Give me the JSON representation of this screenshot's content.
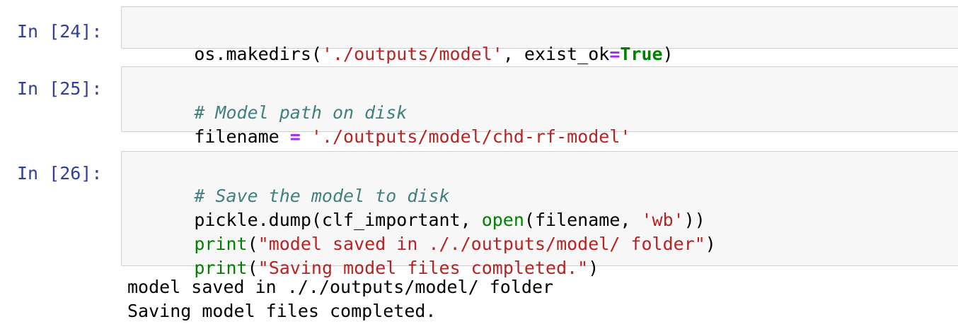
{
  "cells": [
    {
      "prompt": "In [24]:",
      "lines": [
        [
          {
            "t": "os.makedirs(",
            "c": "plain"
          },
          {
            "t": "'./outputs/model'",
            "c": "string"
          },
          {
            "t": ", exist_ok",
            "c": "plain"
          },
          {
            "t": "=",
            "c": "op"
          },
          {
            "t": "True",
            "c": "keyword"
          },
          {
            "t": ")",
            "c": "plain"
          }
        ]
      ]
    },
    {
      "prompt": "In [25]:",
      "lines": [
        [
          {
            "t": "# Model path on disk",
            "c": "comment"
          }
        ],
        [
          {
            "t": "filename ",
            "c": "plain"
          },
          {
            "t": "=",
            "c": "op"
          },
          {
            "t": " ",
            "c": "plain"
          },
          {
            "t": "'./outputs/model/chd-rf-model'",
            "c": "string"
          }
        ]
      ]
    },
    {
      "prompt": "In [26]:",
      "lines": [
        [
          {
            "t": "# Save the model to disk",
            "c": "comment"
          }
        ],
        [
          {
            "t": "pickle.dump(clf_important, ",
            "c": "plain"
          },
          {
            "t": "open",
            "c": "builtin"
          },
          {
            "t": "(filename, ",
            "c": "plain"
          },
          {
            "t": "'wb'",
            "c": "string"
          },
          {
            "t": "))",
            "c": "plain"
          }
        ],
        [
          {
            "t": "print",
            "c": "builtin"
          },
          {
            "t": "(",
            "c": "plain"
          },
          {
            "t": "\"model saved in ././outputs/model/ folder\"",
            "c": "string"
          },
          {
            "t": ")",
            "c": "plain"
          }
        ],
        [
          {
            "t": "print",
            "c": "builtin"
          },
          {
            "t": "(",
            "c": "plain"
          },
          {
            "t": "\"Saving model files completed.\"",
            "c": "string"
          },
          {
            "t": ")",
            "c": "plain"
          }
        ]
      ],
      "output": [
        "model saved in ././outputs/model/ folder",
        "Saving model files completed."
      ]
    }
  ]
}
